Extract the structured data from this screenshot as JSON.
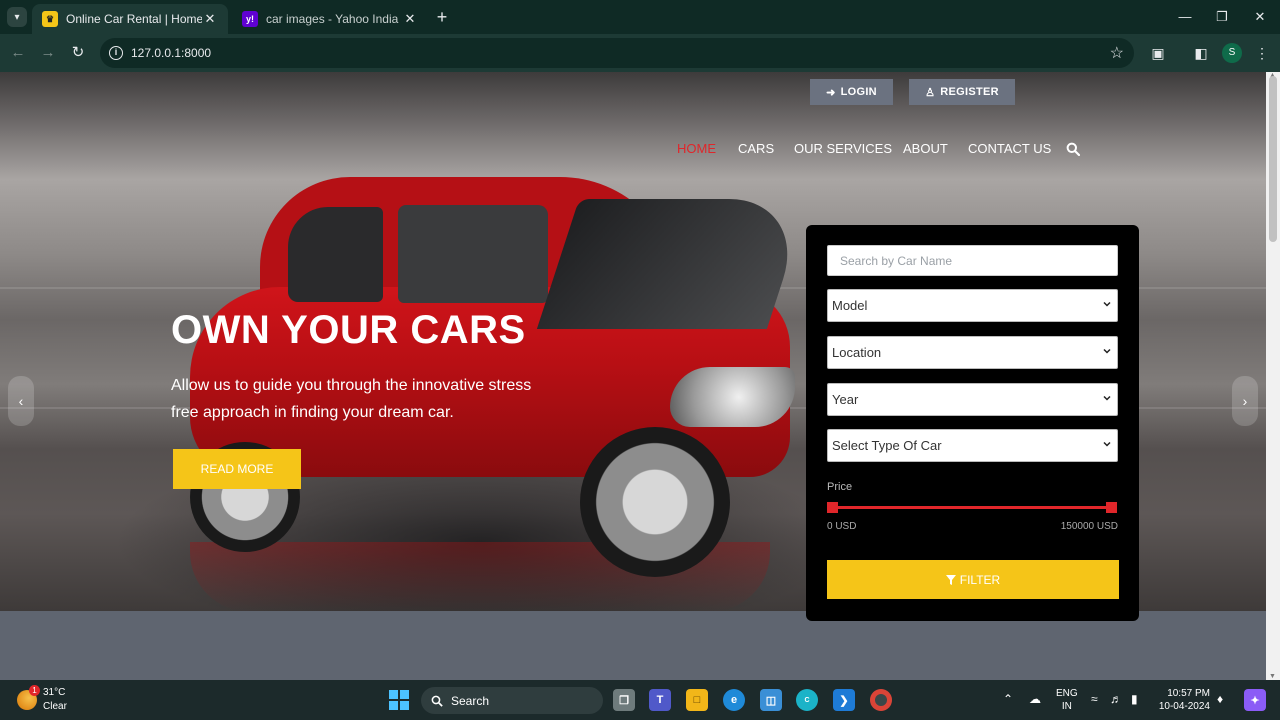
{
  "browser": {
    "tabs": [
      {
        "title": "Online Car Rental | Home",
        "active": true
      },
      {
        "title": "car images - Yahoo India Image Search",
        "active": false
      }
    ],
    "url": "127.0.0.1:8000",
    "profile_initial": "S"
  },
  "header": {
    "login_label": "LOGIN",
    "register_label": "REGISTER",
    "nav": [
      {
        "label": "HOME",
        "active": true
      },
      {
        "label": "CARS"
      },
      {
        "label": "OUR SERVICES"
      },
      {
        "label": "ABOUT"
      },
      {
        "label": "CONTACT US"
      }
    ]
  },
  "hero": {
    "title": "OWN YOUR CARS",
    "subtitle": "Allow us to guide you through the innovative stress free approach in finding your dream car.",
    "cta_label": "READ MORE"
  },
  "filter": {
    "search_placeholder": "Search by Car Name",
    "selects": [
      "Model",
      "Location",
      "Year",
      "Select Type Of Car"
    ],
    "price_label": "Price",
    "price_min": "0 USD",
    "price_max": "150000 USD",
    "button_label": "FILTER"
  },
  "taskbar": {
    "weather_temp": "31°C",
    "weather_condition": "Clear",
    "weather_badge": "1",
    "search_label": "Search",
    "lang_line1": "ENG",
    "lang_line2": "IN",
    "time": "10:57 PM",
    "date": "10-04-2024"
  },
  "colors": {
    "accent_yellow": "#f5c518",
    "accent_red": "#e0262a",
    "browser_frame": "#1d3a35"
  }
}
